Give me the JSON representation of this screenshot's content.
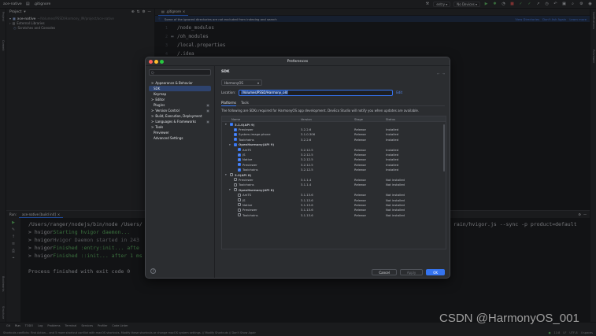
{
  "titlebar": {
    "project": "ace-native",
    "file": ".gitignore",
    "vcs": "entry",
    "devices": "No Devices"
  },
  "project_panel": {
    "title": "Project",
    "items": [
      {
        "label": "ace-native",
        "path": "~/Volumes/PSSD/Harmony_IM/project/ace-native"
      },
      {
        "label": "External Libraries",
        "path": ""
      },
      {
        "label": "Scratches and Consoles",
        "path": ""
      }
    ]
  },
  "editor": {
    "tab": ".gitignore",
    "banner": {
      "text": "Some of the ignored directories are not excluded from indexing and search",
      "actions": [
        "View Directories",
        "Don't Ask Again",
        "Learn more"
      ]
    },
    "lines": [
      {
        "num": "1",
        "text": "/node_modules"
      },
      {
        "num": "2",
        "text": "/oh_modules"
      },
      {
        "num": "3",
        "text": "/local.properties"
      },
      {
        "num": "4",
        "text": "/.idea"
      }
    ]
  },
  "run": {
    "label": "Run:",
    "config": "ace-native [build init]",
    "lines": [
      {
        "pre": "/Users/ranger/nodejs/bin/node /Users/",
        "cls": "",
        "tail": "rain/hvigor.js --sync -p product=default"
      },
      {
        "pre": "> hvigor ",
        "cls": "green",
        "msg": "Starting hvigor daemon..."
      },
      {
        "pre": "> hvigor ",
        "cls": "gray",
        "msg": "Hvigor Daemon started in 243"
      },
      {
        "pre": "> hvigor ",
        "cls": "green",
        "msg": "Finished :entry:init... afte"
      },
      {
        "pre": "> hvigor ",
        "cls": "green",
        "msg": "Finished ::init... after 1 ms"
      },
      {
        "pre": "",
        "cls": "",
        "msg": ""
      },
      {
        "pre": "Process finished with exit code 0",
        "cls": "",
        "msg": ""
      }
    ]
  },
  "bottom_tabs": [
    "Git",
    "Run",
    "TODO",
    "Log",
    "Problems",
    "Terminal",
    "Services",
    "Profiler",
    "Code Linter"
  ],
  "statusbar": {
    "message": "Shortcuts conflicts: Find Action... and 5 more shortcut conflict with macOS shortcuts. Modify these shortcuts or change macOS system settings. // Modify Shortcuts // Don't Show Again",
    "position": "11:8",
    "lf": "LF",
    "encoding": "UTF-8",
    "indent": "4 spaces"
  },
  "watermark": "CSDN @HarmonyOS_001",
  "dialog": {
    "title": "Preferences",
    "search_placeholder": "Q-",
    "nav": [
      {
        "label": "Appearance & Behavior",
        "arrow": ">",
        "badge": "",
        "selected": false
      },
      {
        "label": "SDK",
        "arrow": "",
        "badge": "",
        "selected": true
      },
      {
        "label": "Keymap",
        "arrow": "",
        "badge": "",
        "selected": false
      },
      {
        "label": "Editor",
        "arrow": ">",
        "badge": "",
        "selected": false
      },
      {
        "label": "Plugins",
        "arrow": "",
        "badge": "▣",
        "selected": false
      },
      {
        "label": "Version Control",
        "arrow": ">",
        "badge": "▣",
        "selected": false
      },
      {
        "label": "Build, Execution, Deployment",
        "arrow": ">",
        "badge": "",
        "selected": false
      },
      {
        "label": "Languages & Frameworks",
        "arrow": ">",
        "badge": "▣",
        "selected": false
      },
      {
        "label": "Tools",
        "arrow": ">",
        "badge": "",
        "selected": false
      },
      {
        "label": "Previewer",
        "arrow": "",
        "badge": "",
        "selected": false
      },
      {
        "label": "Advanced Settings",
        "arrow": "",
        "badge": "",
        "selected": false
      }
    ],
    "crumb": "SDK",
    "sdk_select": "HarmonyOS",
    "location_label": "Location:",
    "location_value": "/Volumes/PSSD/Harmony_old",
    "edit": "Edit",
    "subtabs": [
      "Platforms",
      "Tools"
    ],
    "description": "The following are SDKs required for HarmonyOS app development. DevEco Studio will notify you when updates are available.",
    "columns": [
      "Name",
      "Version",
      "Stage",
      "Status"
    ],
    "rows": [
      {
        "indent": 0,
        "arrow": "v",
        "checked": "partial",
        "name": "3.1.0(API 9)",
        "version": "",
        "stage": "",
        "status": "",
        "bold": true
      },
      {
        "indent": 1,
        "arrow": "",
        "checked": true,
        "name": "Previewer",
        "version": "3.2.2.6",
        "stage": "Release",
        "status": "Installed",
        "bold": false
      },
      {
        "indent": 1,
        "arrow": "",
        "checked": true,
        "name": "System-image-phone",
        "version": "3.1.0.306",
        "stage": "Release",
        "status": "Installed",
        "bold": false
      },
      {
        "indent": 1,
        "arrow": "",
        "checked": true,
        "name": "Toolchains",
        "version": "3.2.2.6",
        "stage": "Release",
        "status": "Installed",
        "bold": false
      },
      {
        "indent": 1,
        "arrow": "v",
        "checked": "partial",
        "name": "OpenHarmony(API 9)",
        "version": "",
        "stage": "",
        "status": "",
        "bold": true
      },
      {
        "indent": 2,
        "arrow": "",
        "checked": true,
        "name": "ArkTS",
        "version": "3.2.12.5",
        "stage": "Release",
        "status": "Installed",
        "bold": false
      },
      {
        "indent": 2,
        "arrow": "",
        "checked": true,
        "name": "JS",
        "version": "3.2.12.5",
        "stage": "Release",
        "status": "Installed",
        "bold": false
      },
      {
        "indent": 2,
        "arrow": "",
        "checked": true,
        "name": "Native",
        "version": "3.2.12.5",
        "stage": "Release",
        "status": "Installed",
        "bold": false
      },
      {
        "indent": 2,
        "arrow": "",
        "checked": true,
        "name": "Previewer",
        "version": "3.2.12.5",
        "stage": "Release",
        "status": "Installed",
        "bold": false
      },
      {
        "indent": 2,
        "arrow": "",
        "checked": true,
        "name": "Toolchains",
        "version": "3.2.12.5",
        "stage": "Release",
        "status": "Installed",
        "bold": false
      },
      {
        "indent": 0,
        "arrow": "v",
        "checked": false,
        "name": "3.0(API 8)",
        "version": "",
        "stage": "",
        "status": "",
        "bold": true
      },
      {
        "indent": 1,
        "arrow": "",
        "checked": false,
        "name": "Previewer",
        "version": "3.1.1.4",
        "stage": "Release",
        "status": "Not installed",
        "bold": false
      },
      {
        "indent": 1,
        "arrow": "",
        "checked": false,
        "name": "Toolchains",
        "version": "3.1.1.4",
        "stage": "Release",
        "status": "Not installed",
        "bold": false
      },
      {
        "indent": 1,
        "arrow": "v",
        "checked": false,
        "name": "OpenHarmony(API 8)",
        "version": "",
        "stage": "",
        "status": "",
        "bold": true
      },
      {
        "indent": 2,
        "arrow": "",
        "checked": false,
        "name": "ArkTS",
        "version": "3.1.13.6",
        "stage": "Release",
        "status": "Not installed",
        "bold": false
      },
      {
        "indent": 2,
        "arrow": "",
        "checked": false,
        "name": "JS",
        "version": "3.1.13.6",
        "stage": "Release",
        "status": "Not installed",
        "bold": false
      },
      {
        "indent": 2,
        "arrow": "",
        "checked": false,
        "name": "Native",
        "version": "3.1.13.6",
        "stage": "Release",
        "status": "Not installed",
        "bold": false
      },
      {
        "indent": 2,
        "arrow": "",
        "checked": false,
        "name": "Previewer",
        "version": "3.1.13.6",
        "stage": "Release",
        "status": "Not installed",
        "bold": false
      },
      {
        "indent": 2,
        "arrow": "",
        "checked": false,
        "name": "Toolchains",
        "version": "3.1.13.6",
        "stage": "Release",
        "status": "Not installed",
        "bold": false
      }
    ],
    "buttons": {
      "cancel": "Cancel",
      "apply": "Apply",
      "ok": "OK"
    },
    "help": "?"
  },
  "colors": {
    "accent": "#3574f0",
    "selection": "#2e436e",
    "banner": "#25324d",
    "ok_green": "#5fb865"
  }
}
